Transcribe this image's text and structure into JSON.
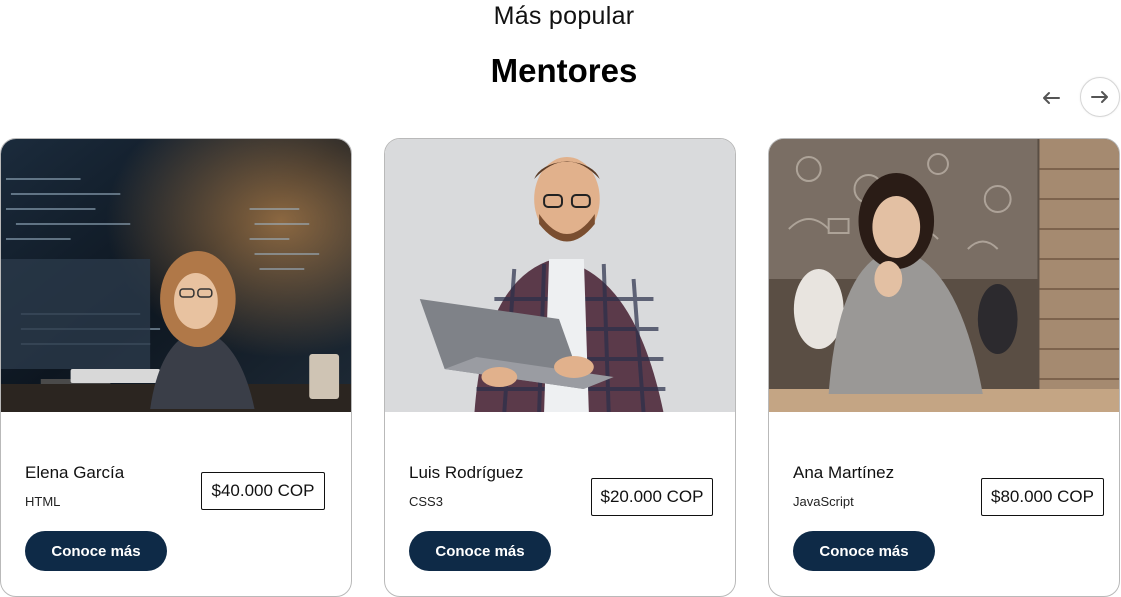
{
  "header": {
    "subtitle": "Más popular",
    "title": "Mentores",
    "prev_icon": "arrow-left-icon",
    "next_icon": "arrow-right-icon"
  },
  "cards": [
    {
      "name": "Elena García",
      "skill": "HTML",
      "price": "$40.000 COP",
      "cta": "Conoce más",
      "image": "woman-coding-at-computer-photo"
    },
    {
      "name": "Luis Rodríguez",
      "skill": "CSS3",
      "price": "$20.000 COP",
      "cta": "Conoce más",
      "image": "man-holding-laptop-photo"
    },
    {
      "name": "Ana Martínez",
      "skill": "JavaScript",
      "price": "$80.000 COP",
      "cta": "Conoce más",
      "image": "woman-in-cafe-photo"
    }
  ],
  "colors": {
    "cta_background": "#0e2a47",
    "card_border": "#b9b9b9"
  }
}
